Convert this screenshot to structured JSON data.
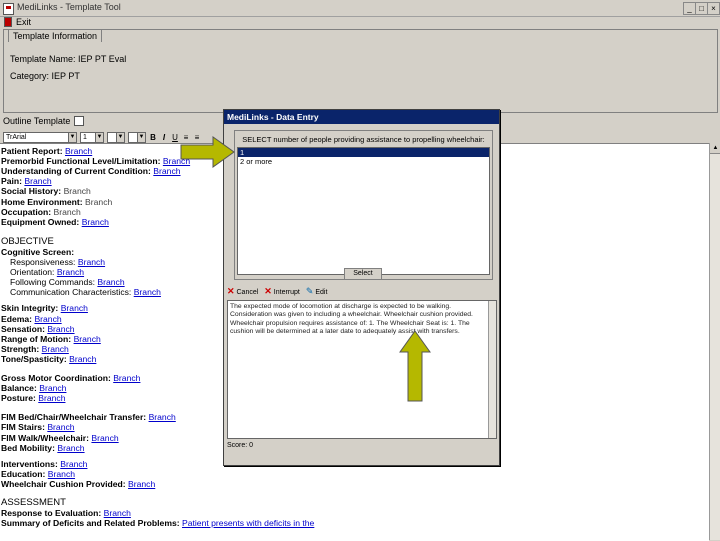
{
  "window": {
    "title": "MediLinks - Template Tool",
    "min": "_",
    "max": "□",
    "close": "×"
  },
  "menu": {
    "item": "Exit"
  },
  "template": {
    "tab": "Template Information",
    "name_line": "Template Name: IEP PT Eval",
    "category_line": "Category: IEP PT"
  },
  "outline": {
    "label": "Outline Template"
  },
  "toolbar": {
    "font": "TrArial",
    "size": "1",
    "bold": "B",
    "italic": "I",
    "underline": "U"
  },
  "document": {
    "lines": [
      {
        "label": "Patient Report:",
        "value": "Branch",
        "link": true
      },
      {
        "label": "Premorbid Functional Level/Limitation:",
        "value": "Branch",
        "link": true
      },
      {
        "label": "Understanding of Current Condition:",
        "value": "Branch",
        "link": true
      },
      {
        "label": "Pain:",
        "value": "Branch",
        "link": true
      },
      {
        "label": "Social History:",
        "value": "Branch",
        "link": false
      },
      {
        "label": "Home Environment:",
        "value": "Branch",
        "link": false
      },
      {
        "label": "Occupation:",
        "value": "Branch",
        "link": false
      },
      {
        "label": "Equipment Owned:",
        "value": "Branch",
        "link": true
      }
    ],
    "objective_heading": "OBJECTIVE",
    "cognitive_heading": "Cognitive Screen:",
    "cognitive": [
      {
        "label": "Responsiveness:",
        "value": "Branch"
      },
      {
        "label": "Orientation:",
        "value": "Branch"
      },
      {
        "label": "Following Commands:",
        "value": "Branch"
      },
      {
        "label": "Communication Characteristics:",
        "value": "Branch"
      }
    ],
    "exam": [
      {
        "label": "Skin Integrity:",
        "value": "Branch"
      },
      {
        "label": "Edema:",
        "value": "Branch"
      },
      {
        "label": "Sensation:",
        "value": "Branch"
      },
      {
        "label": "Range of Motion:",
        "value": "Branch"
      },
      {
        "label": "Strength:",
        "value": "Branch"
      },
      {
        "label": "Tone/Spasticity:",
        "value": "Branch"
      }
    ],
    "motor": [
      {
        "label": "Gross Motor Coordination:",
        "value": "Branch"
      },
      {
        "label": "Balance:",
        "value": "Branch"
      },
      {
        "label": "Posture:",
        "value": "Branch"
      }
    ],
    "fim": [
      {
        "label": "FIM Bed/Chair/Wheelchair Transfer:",
        "value": "Branch"
      },
      {
        "label": "FIM Stairs:",
        "value": "Branch"
      },
      {
        "label": "FIM Walk/Wheelchair:",
        "value": "Branch"
      },
      {
        "label": "Bed Mobility:",
        "value": "Branch"
      }
    ],
    "plan": [
      {
        "label": "Interventions:",
        "value": "Branch"
      },
      {
        "label": "Education:",
        "value": "Branch"
      },
      {
        "label": "Wheelchair Cushion Provided:",
        "value": "Branch"
      }
    ],
    "assessment_heading": "ASSESSMENT",
    "assessment": [
      {
        "label": "Response to Evaluation:",
        "value": "Branch"
      },
      {
        "label": "Summary of Deficits and Related Problems:",
        "value": "Patient presents with deficits in the"
      }
    ]
  },
  "dialog": {
    "title": "MediLinks - Data Entry",
    "prompt": "SELECT number of people providing assistance to propelling wheelchair:",
    "options": [
      "1",
      "2 or more"
    ],
    "select_button": "Select",
    "cancel_label": "Cancel",
    "interrupt_label": "Interrupt",
    "edit_label": "Edit",
    "text": "The expected mode of locomotion at discharge is expected to be walking. Consideration was given to including a wheelchair. Wheelchair cushion provided. Wheelchair propulsion requires assistance of: 1. The Wheelchair Seat is: 1. The cushion will be determined at a later date to adequately assist with transfers.",
    "status": "Score: 0"
  },
  "colors": {
    "highlight": "#0a246a",
    "link": "#0000cc",
    "arrow": "#b5b800"
  }
}
